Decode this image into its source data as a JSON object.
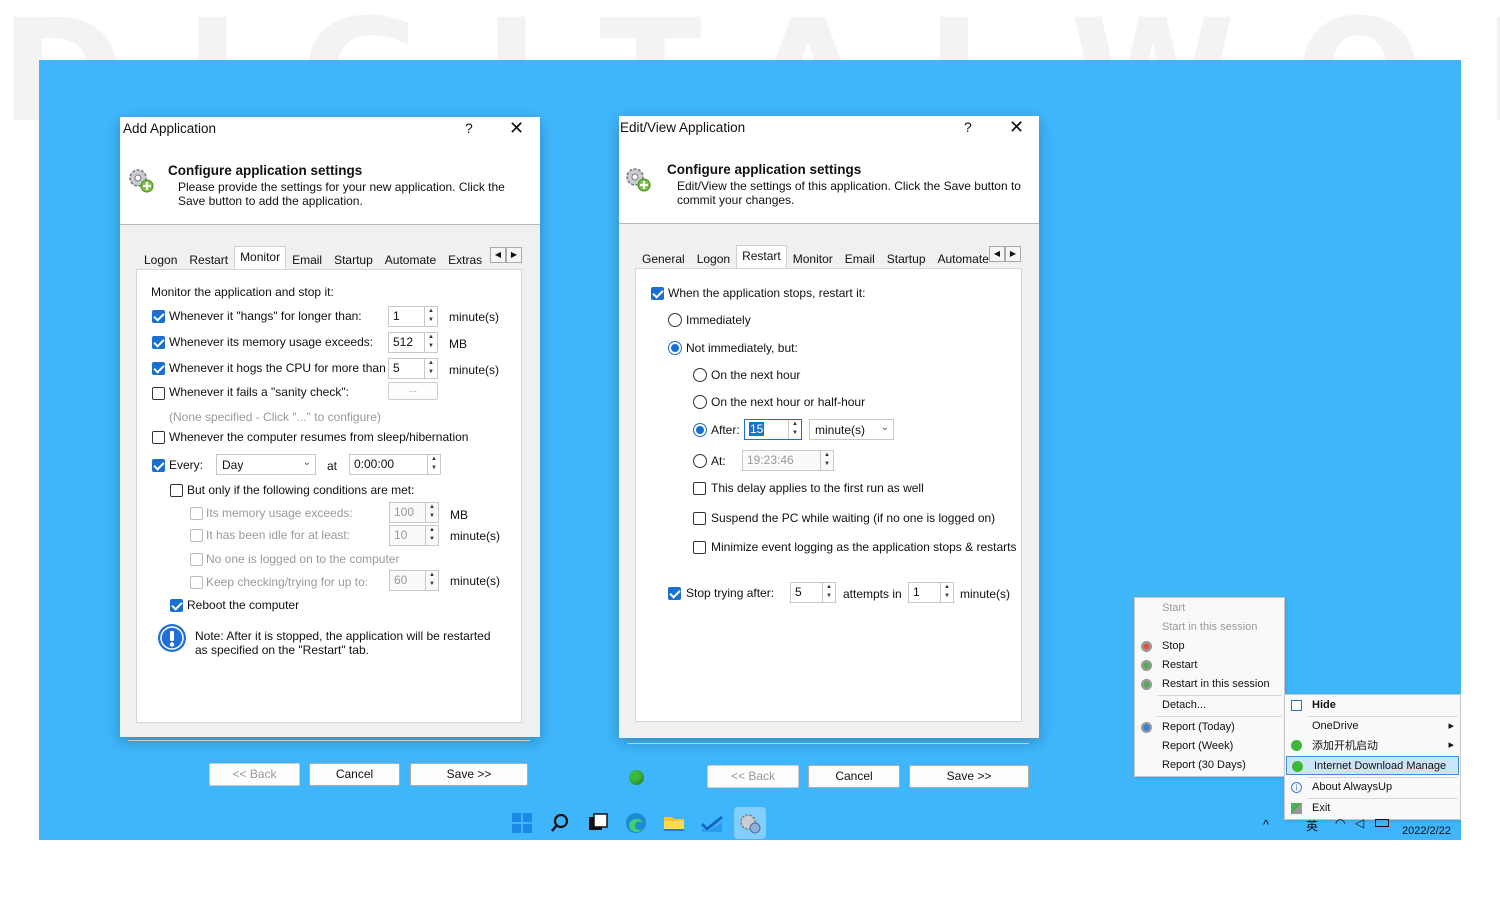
{
  "colors": {
    "desktop": "#3fb6fc",
    "accent": "#1a6fd1",
    "dialog_bg": "#f0f0f0"
  },
  "add_app": {
    "title": "Add Application",
    "help": "?",
    "close": "✕",
    "header_title": "Configure application settings",
    "header_desc": "Please provide the settings for your new application. Click the Save button to add the application.",
    "tabs": [
      "Logon",
      "Restart",
      "Monitor",
      "Email",
      "Startup",
      "Automate",
      "Extras"
    ],
    "selected_tab": "Monitor",
    "monitor_label": "Monitor the application and stop it:",
    "hangs_label": "Whenever it \"hangs\" for longer than:",
    "hangs_value": "1",
    "hangs_unit": "minute(s)",
    "memory_label": "Whenever its memory usage exceeds:",
    "memory_value": "512",
    "memory_unit": "MB",
    "cpu_label": "Whenever it hogs the CPU for more than",
    "cpu_value": "5",
    "cpu_unit": "minute(s)",
    "sanity_label": "Whenever it fails a \"sanity check\":",
    "sanity_btn": "...",
    "sanity_none": "(None specified - Click \"...\" to configure)",
    "resume_label": "Whenever the computer resumes from sleep/hibernation",
    "every_label": "Every:",
    "every_value": "Day",
    "at_label": "at",
    "at_value": "0:00:00",
    "conditions_label": "But only if the following conditions are met:",
    "cond_mem_label": "Its memory usage exceeds:",
    "cond_mem_value": "100",
    "cond_mem_unit": "MB",
    "cond_idle_label": "It has been idle for at least:",
    "cond_idle_value": "10",
    "cond_idle_unit": "minute(s)",
    "cond_nologon_label": "No one is logged on to the computer",
    "cond_keep_label": "Keep checking/trying for up to:",
    "cond_keep_value": "60",
    "cond_keep_unit": "minute(s)",
    "reboot_label": "Reboot the computer",
    "note": "Note: After it is stopped, the application will be restarted as specified on the \"Restart\" tab.",
    "back": "<< Back",
    "cancel": "Cancel",
    "save": "Save >>"
  },
  "edit_app": {
    "title": "Edit/View Application",
    "help": "?",
    "close": "✕",
    "header_title": "Configure application settings",
    "header_desc": "Edit/View the settings of this application. Click the Save button to commit your changes.",
    "tabs": [
      "General",
      "Logon",
      "Restart",
      "Monitor",
      "Email",
      "Startup",
      "Automate"
    ],
    "selected_tab": "Restart",
    "when_stops_label": "When the application stops, restart it:",
    "immediately_label": "Immediately",
    "not_immediately_label": "Not immediately, but:",
    "next_hour_label": "On the next hour",
    "next_half_hour_label": "On the next hour or half-hour",
    "after_label": "After:",
    "after_value": "15",
    "after_unit": "minute(s)",
    "at_label": "At:",
    "at_value": "19:23:46",
    "delay_first_label": "This delay applies to the first run as well",
    "suspend_label": "Suspend the PC while waiting (if no one is logged on)",
    "minimize_label": "Minimize event logging as the application stops & restarts",
    "stop_trying_label": "Stop trying after:",
    "attempts_value": "5",
    "attempts_in_label": "attempts in",
    "minutes_value": "1",
    "minutes_unit": "minute(s)",
    "back": "<< Back",
    "cancel": "Cancel",
    "save": "Save >>"
  },
  "context_menu": {
    "items": [
      "Start",
      "Start in this session",
      "Stop",
      "Restart",
      "Restart in this session",
      "Detach...",
      "Report (Today)",
      "Report (Week)",
      "Report (30 Days)"
    ]
  },
  "tray_menu": {
    "items": [
      "Hide",
      "OneDrive",
      "添加开机启动",
      "Internet Download Manage",
      "About AlwaysUp",
      "Exit"
    ]
  },
  "taskbar": {
    "date": "2022/2/22",
    "ime": "英",
    "up_arrow": "^"
  }
}
